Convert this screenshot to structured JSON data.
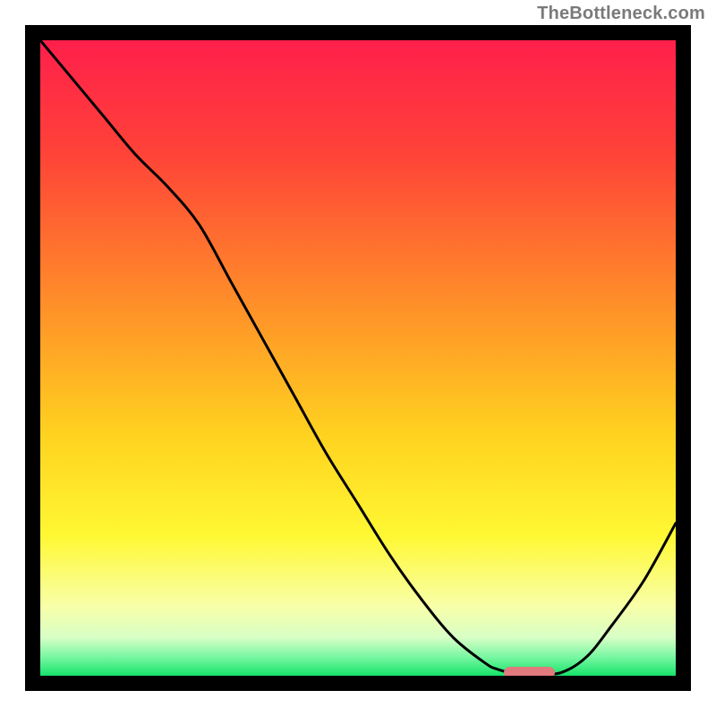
{
  "watermark": "TheBottleneck.com",
  "chart_data": {
    "type": "line",
    "title": "",
    "xlabel": "",
    "ylabel": "",
    "xlim": [
      0,
      100
    ],
    "ylim": [
      0,
      100
    ],
    "gradient_stops": [
      {
        "pct": 0,
        "color": "#ff1f4b"
      },
      {
        "pct": 18,
        "color": "#ff4338"
      },
      {
        "pct": 40,
        "color": "#ff8a2a"
      },
      {
        "pct": 62,
        "color": "#ffd21f"
      },
      {
        "pct": 78,
        "color": "#fff833"
      },
      {
        "pct": 89,
        "color": "#f8ffa8"
      },
      {
        "pct": 94,
        "color": "#d8ffc6"
      },
      {
        "pct": 97,
        "color": "#7af7a2"
      },
      {
        "pct": 100,
        "color": "#17e36a"
      }
    ],
    "curve": {
      "x": [
        0,
        5,
        10,
        15,
        20,
        25,
        30,
        35,
        40,
        45,
        50,
        55,
        60,
        65,
        70,
        72,
        75,
        78,
        82,
        86,
        90,
        95,
        100
      ],
      "y": [
        100,
        94,
        88,
        82,
        77,
        71,
        62,
        53,
        44,
        35,
        27,
        19,
        12,
        6,
        2,
        1,
        0.3,
        0.3,
        0.5,
        3,
        8,
        15,
        24
      ]
    },
    "optimal_marker": {
      "x_start": 73,
      "x_end": 81,
      "y": 0.6,
      "color": "#e17a7d"
    }
  }
}
